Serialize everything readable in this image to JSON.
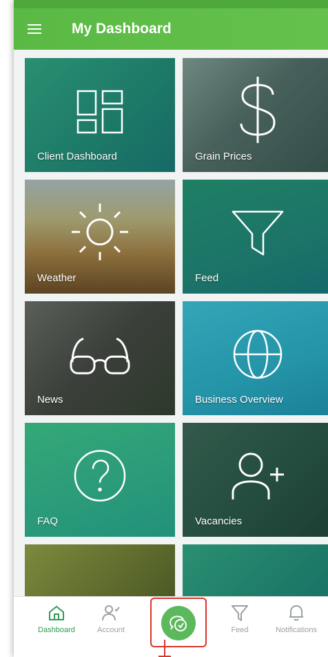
{
  "header": {
    "title": "My Dashboard"
  },
  "tiles": [
    {
      "label": "Client Dashboard",
      "icon": "dashboard-grid-icon"
    },
    {
      "label": "Grain Prices",
      "icon": "dollar-icon"
    },
    {
      "label": "Weather",
      "icon": "sun-icon"
    },
    {
      "label": "Feed",
      "icon": "funnel-icon"
    },
    {
      "label": "News",
      "icon": "glasses-icon"
    },
    {
      "label": "Business Overview",
      "icon": "globe-icon"
    },
    {
      "label": "FAQ",
      "icon": "question-icon"
    },
    {
      "label": "Vacancies",
      "icon": "add-user-icon"
    }
  ],
  "bottom_nav": {
    "items": [
      {
        "label": "Dashboard",
        "icon": "home-icon",
        "active": true
      },
      {
        "label": "Account",
        "icon": "user-check-icon"
      },
      {
        "label": "Feed",
        "icon": "funnel-icon"
      },
      {
        "label": "Notifications",
        "icon": "bell-icon"
      }
    ],
    "center_icon": "chat-icon"
  },
  "colors": {
    "primary_green": "#5ab944",
    "active_nav": "#2f9a52",
    "highlight_red": "#d9342b"
  }
}
